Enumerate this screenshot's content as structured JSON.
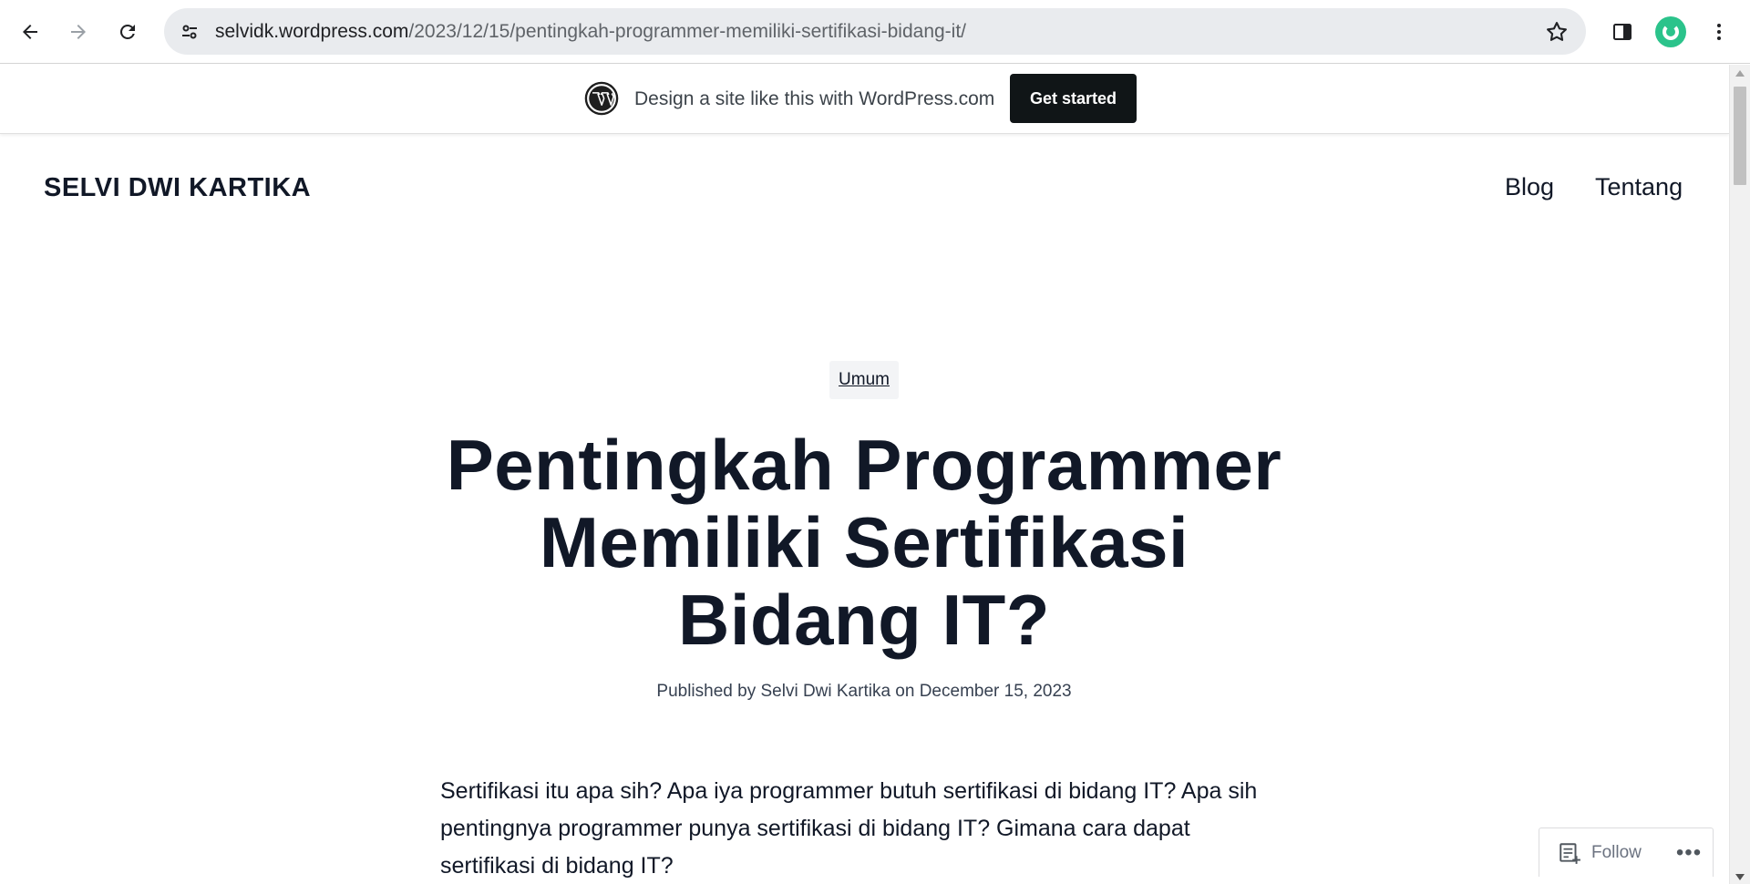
{
  "browser": {
    "url_host": "selvidk.wordpress.com",
    "url_path": "/2023/12/15/pentingkah-programmer-memiliki-sertifikasi-bidang-it/",
    "icons": [
      "back-icon",
      "forward-icon",
      "reload-icon",
      "site-info-icon",
      "bookmark-star-icon",
      "side-panel-icon",
      "profile-avatar",
      "menu-icon"
    ],
    "avatar_color": "#2bc38b"
  },
  "banner": {
    "text": "Design a site like this with WordPress.com",
    "cta_label": "Get started",
    "cta_color": "#101517"
  },
  "site": {
    "title": "SELVI DWI KARTIKA",
    "nav": [
      "Blog",
      "Tentang"
    ]
  },
  "post": {
    "category": "Umum",
    "title_lines": [
      "Pentingkah Programmer",
      "Memiliki Sertifikasi",
      "Bidang IT?"
    ],
    "byline": "Published by Selvi Dwi Kartika on December 15, 2023",
    "paragraph": "Sertifikasi itu apa sih? Apa iya programmer butuh sertifikasi di bidang IT? Apa sih pentingnya programmer punya sertifikasi di bidang IT? Gimana cara dapat sertifikasi di bidang IT?"
  },
  "follow": {
    "label": "Follow",
    "more_label": "•••"
  }
}
